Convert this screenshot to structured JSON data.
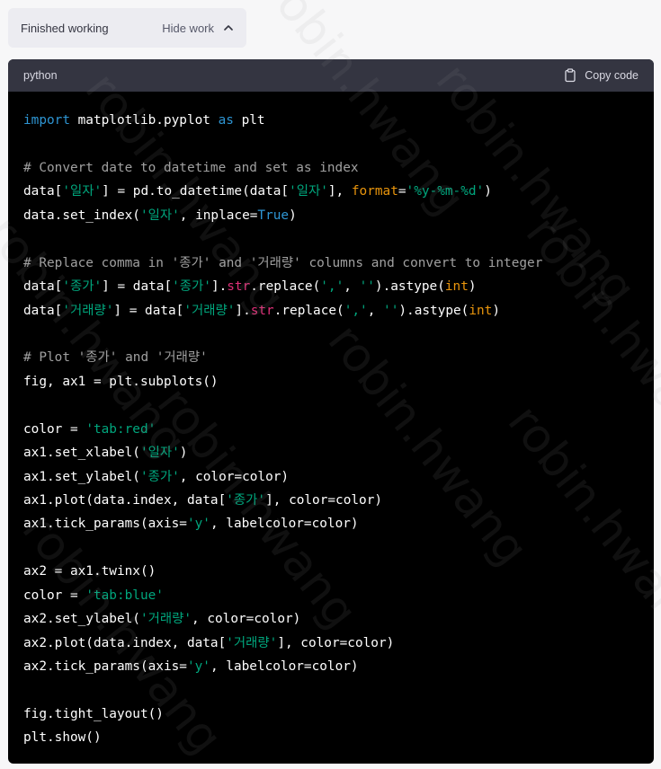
{
  "status": {
    "text": "Finished working",
    "hide_label": "Hide work"
  },
  "code_block": {
    "language": "python",
    "copy_label": "Copy code",
    "lines": [
      [
        {
          "t": "kw",
          "v": "import"
        },
        {
          "t": "pl",
          "v": " matplotlib.pyplot "
        },
        {
          "t": "kw",
          "v": "as"
        },
        {
          "t": "pl",
          "v": " plt"
        }
      ],
      [],
      [
        {
          "t": "cm",
          "v": "# Convert date to datetime and set as index"
        }
      ],
      [
        {
          "t": "pl",
          "v": "data["
        },
        {
          "t": "st",
          "v": "'일자'"
        },
        {
          "t": "pl",
          "v": "] = pd.to_datetime(data["
        },
        {
          "t": "st",
          "v": "'일자'"
        },
        {
          "t": "pl",
          "v": "], "
        },
        {
          "t": "bi",
          "v": "format"
        },
        {
          "t": "pl",
          "v": "="
        },
        {
          "t": "st",
          "v": "'%y-%m-%d'"
        },
        {
          "t": "pl",
          "v": ")"
        }
      ],
      [
        {
          "t": "pl",
          "v": "data.set_index("
        },
        {
          "t": "st",
          "v": "'일자'"
        },
        {
          "t": "pl",
          "v": ", inplace="
        },
        {
          "t": "kw",
          "v": "True"
        },
        {
          "t": "pl",
          "v": ")"
        }
      ],
      [],
      [
        {
          "t": "cm",
          "v": "# Replace comma in '종가' and '거래량' columns and convert to integer"
        }
      ],
      [
        {
          "t": "pl",
          "v": "data["
        },
        {
          "t": "st",
          "v": "'종가'"
        },
        {
          "t": "pl",
          "v": "] = data["
        },
        {
          "t": "st",
          "v": "'종가'"
        },
        {
          "t": "pl",
          "v": "]."
        },
        {
          "t": "nb",
          "v": "str"
        },
        {
          "t": "pl",
          "v": ".replace("
        },
        {
          "t": "st",
          "v": "','"
        },
        {
          "t": "pl",
          "v": ", "
        },
        {
          "t": "st",
          "v": "''"
        },
        {
          "t": "pl",
          "v": ").astype("
        },
        {
          "t": "bi",
          "v": "int"
        },
        {
          "t": "pl",
          "v": ")"
        }
      ],
      [
        {
          "t": "pl",
          "v": "data["
        },
        {
          "t": "st",
          "v": "'거래량'"
        },
        {
          "t": "pl",
          "v": "] = data["
        },
        {
          "t": "st",
          "v": "'거래량'"
        },
        {
          "t": "pl",
          "v": "]."
        },
        {
          "t": "nb",
          "v": "str"
        },
        {
          "t": "pl",
          "v": ".replace("
        },
        {
          "t": "st",
          "v": "','"
        },
        {
          "t": "pl",
          "v": ", "
        },
        {
          "t": "st",
          "v": "''"
        },
        {
          "t": "pl",
          "v": ").astype("
        },
        {
          "t": "bi",
          "v": "int"
        },
        {
          "t": "pl",
          "v": ")"
        }
      ],
      [],
      [
        {
          "t": "cm",
          "v": "# Plot '종가' and '거래량'"
        }
      ],
      [
        {
          "t": "pl",
          "v": "fig, ax1 = plt.subplots()"
        }
      ],
      [],
      [
        {
          "t": "pl",
          "v": "color = "
        },
        {
          "t": "st",
          "v": "'tab:red'"
        }
      ],
      [
        {
          "t": "pl",
          "v": "ax1.set_xlabel("
        },
        {
          "t": "st",
          "v": "'일자'"
        },
        {
          "t": "pl",
          "v": ")"
        }
      ],
      [
        {
          "t": "pl",
          "v": "ax1.set_ylabel("
        },
        {
          "t": "st",
          "v": "'종가'"
        },
        {
          "t": "pl",
          "v": ", color=color)"
        }
      ],
      [
        {
          "t": "pl",
          "v": "ax1.plot(data.index, data["
        },
        {
          "t": "st",
          "v": "'종가'"
        },
        {
          "t": "pl",
          "v": "], color=color)"
        }
      ],
      [
        {
          "t": "pl",
          "v": "ax1.tick_params(axis="
        },
        {
          "t": "st",
          "v": "'y'"
        },
        {
          "t": "pl",
          "v": ", labelcolor=color)"
        }
      ],
      [],
      [
        {
          "t": "pl",
          "v": "ax2 = ax1.twinx()"
        }
      ],
      [
        {
          "t": "pl",
          "v": "color = "
        },
        {
          "t": "st",
          "v": "'tab:blue'"
        }
      ],
      [
        {
          "t": "pl",
          "v": "ax2.set_ylabel("
        },
        {
          "t": "st",
          "v": "'거래량'"
        },
        {
          "t": "pl",
          "v": ", color=color)"
        }
      ],
      [
        {
          "t": "pl",
          "v": "ax2.plot(data.index, data["
        },
        {
          "t": "st",
          "v": "'거래량'"
        },
        {
          "t": "pl",
          "v": "], color=color)"
        }
      ],
      [
        {
          "t": "pl",
          "v": "ax2.tick_params(axis="
        },
        {
          "t": "st",
          "v": "'y'"
        },
        {
          "t": "pl",
          "v": ", labelcolor=color)"
        }
      ],
      [],
      [
        {
          "t": "pl",
          "v": "fig.tight_layout()"
        }
      ],
      [
        {
          "t": "pl",
          "v": "plt.show()"
        }
      ]
    ]
  },
  "watermark": "robin.hwang",
  "colors": {
    "keyword": "#2e95d3",
    "comment": "#a0a0a0",
    "string": "#00a67d",
    "builtin": "#e9950c",
    "name_builtin": "#df3079",
    "plain": "#ffffff",
    "background": "#000000",
    "header_bg": "#343541"
  }
}
